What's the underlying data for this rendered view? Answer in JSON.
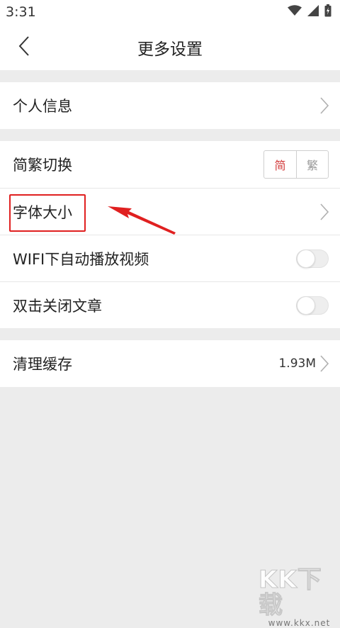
{
  "status_bar": {
    "time": "3:31",
    "icons": [
      "wifi-icon",
      "signal-icon",
      "battery-icon"
    ]
  },
  "header": {
    "title": "更多设置",
    "back_icon": "back-arrow-icon"
  },
  "sections": {
    "personal_info": "个人信息",
    "script_switch": {
      "label": "简繁切换",
      "options": [
        "简",
        "繁"
      ],
      "selected": "简"
    },
    "font_size": "字体大小",
    "wifi_autoplay": {
      "label": "WIFI下自动播放视频",
      "enabled": false
    },
    "double_tap_close": {
      "label": "双击关闭文章",
      "enabled": false
    },
    "clear_cache": {
      "label": "清理缓存",
      "value": "1.93M"
    }
  },
  "watermark": {
    "logo": "KK下载",
    "url": "www.kkx.net"
  },
  "colors": {
    "accent": "#d23a3a",
    "annotation": "#e02020",
    "background": "#ececec"
  }
}
